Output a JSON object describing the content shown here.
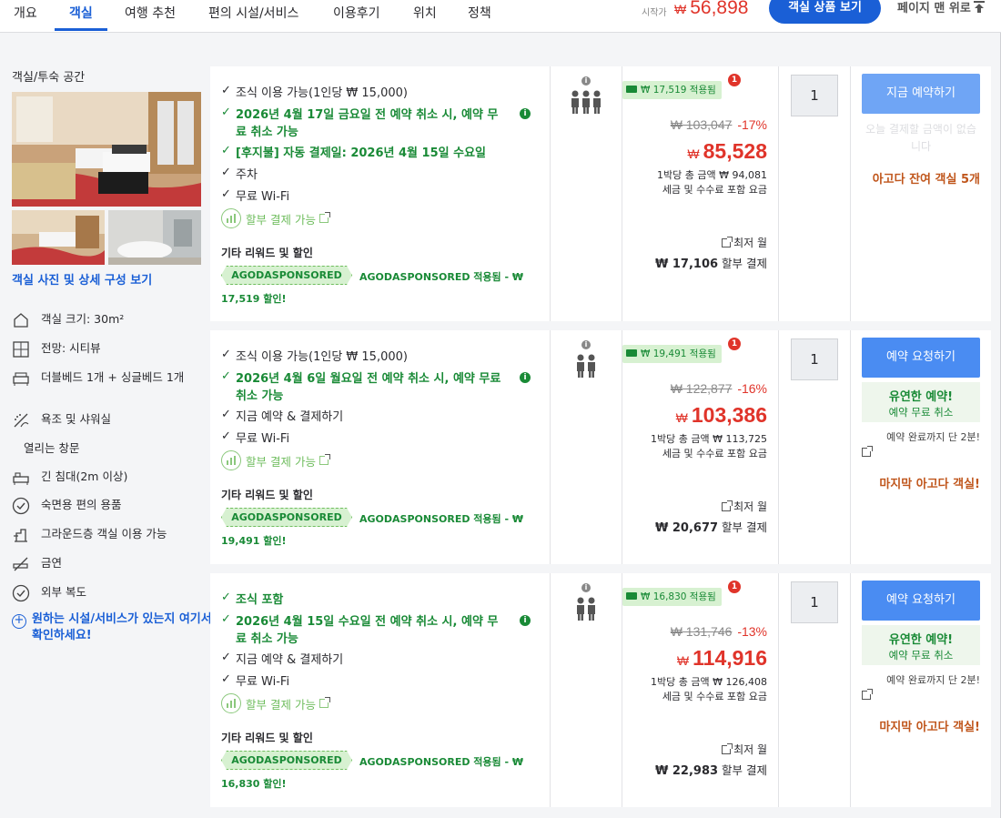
{
  "nav": {
    "tabs": [
      "개요",
      "객실",
      "여행 추천",
      "편의 시설/서비스",
      "이용후기",
      "위치",
      "정책"
    ],
    "start_from_label": "시작가",
    "start_price_currency": "₩",
    "start_price": "56,898",
    "view_button": "객실 상품 보기",
    "back_to_top": "페이지 맨 위로"
  },
  "left": {
    "title": "객실/투숙 공간",
    "photo_link": "객실 사진 및 상세 구성 보기",
    "features": [
      {
        "icon": "room-size-icon",
        "label": "객실 크기: 30m²"
      },
      {
        "icon": "window-view-icon",
        "label": "전망: 시티뷰"
      },
      {
        "icon": "bed-icon",
        "label": "더블베드 1개 + 싱글베드 1개"
      },
      {
        "icon": "shower-icon",
        "label": "욕조 및 샤워실"
      },
      {
        "icon": "",
        "label": "열리는 창문"
      },
      {
        "icon": "long-bed-icon",
        "label": "긴 침대(2m 이상)"
      },
      {
        "icon": "check-circle-icon",
        "label": "숙면용 편의 용품"
      },
      {
        "icon": "ground-floor-icon",
        "label": "그라운드층 객실 이용 가능"
      },
      {
        "icon": "no-smoking-icon",
        "label": "금연"
      },
      {
        "icon": "check-circle-icon",
        "label": "외부 복도"
      }
    ],
    "ask_link": "원하는 시설/서비스가 있는지 여기서 확인하세요!"
  },
  "common": {
    "installment_label": "할부 결제 가능",
    "other_rewards_label": "기타 리워드 및 할인",
    "sponsor_tag": "AGODASPONSORED",
    "monthly_label": "최저 월",
    "installment_suffix": "할부 결제",
    "per_night_prefix": "1박당 총 금액",
    "tax_note": "세금 및 수수료 포함 요금",
    "currency": "₩",
    "info_mark": "i",
    "badge_count": "1"
  },
  "offers": [
    {
      "benefits": [
        {
          "text": "조식 이용 가능(1인당 ₩ 15,000)",
          "green": false
        },
        {
          "text": "2026년 4월 17일 금요일 전 예약 취소 시, 예약 무료 취소 가능",
          "green": true
        },
        {
          "text": "[후지불] 자동 결제일: 2026년 4월 15일 수요일",
          "green": true
        },
        {
          "text": "주차",
          "green": false
        },
        {
          "text": "무료 Wi-Fi",
          "green": false
        }
      ],
      "sponsor_line1": "AGODASPONSORED 적용됨 - ₩",
      "sponsor_line2": "17,519 할인!",
      "occupancy": 3,
      "coupon": "₩ 17,519 적용됨",
      "original_price": "₩ 103,047",
      "discount": "-17%",
      "final_price": "85,528",
      "per_night": "1박당 총 금액 ₩ 94,081",
      "monthly_amount": "₩ 17,106",
      "quantity": "1",
      "book_button": "지금 예약하기",
      "no_pay_note": "오늘 결제할 금액이 없습니다",
      "urgency": "아고다 잔여 객실 5개"
    },
    {
      "benefits": [
        {
          "text": "조식 이용 가능(1인당 ₩ 15,000)",
          "green": false
        },
        {
          "text": "2026년 4월 6일 월요일 전 예약 취소 시, 예약 무료 취소 가능",
          "green": true
        },
        {
          "text": "지금 예약 & 결제하기",
          "green": false
        },
        {
          "text": "무료 Wi-Fi",
          "green": false
        }
      ],
      "sponsor_line1": "AGODASPONSORED 적용됨 - ₩",
      "sponsor_line2": "19,491 할인!",
      "occupancy": 2,
      "coupon": "₩ 19,491 적용됨",
      "original_price": "₩ 122,877",
      "discount": "-16%",
      "final_price": "103,386",
      "per_night": "1박당 총 금액 ₩ 113,725",
      "monthly_amount": "₩ 20,677",
      "quantity": "1",
      "book_button": "예약 요청하기",
      "flex_title": "유연한 예약!",
      "flex_sub": "예약 무료 취소",
      "remain_note": "예약 완료까지 단 2분!",
      "urgency": "마지막 아고다 객실!"
    },
    {
      "benefits": [
        {
          "text": "조식 포함",
          "green": true
        },
        {
          "text": "2026년 4월 15일 수요일 전 예약 취소 시, 예약 무료 취소 가능",
          "green": true
        },
        {
          "text": "지금 예약 & 결제하기",
          "green": false
        },
        {
          "text": "무료 Wi-Fi",
          "green": false
        }
      ],
      "sponsor_line1": "AGODASPONSORED 적용됨 - ₩",
      "sponsor_line2": "16,830 할인!",
      "occupancy": 2,
      "coupon": "₩ 16,830 적용됨",
      "original_price": "₩ 131,746",
      "discount": "-13%",
      "final_price": "114,916",
      "per_night": "1박당 총 금액 ₩ 126,408",
      "monthly_amount": "₩ 22,983",
      "quantity": "1",
      "book_button": "예약 요청하기",
      "flex_title": "유연한 예약!",
      "flex_sub": "예약 무료 취소",
      "remain_note": "예약 완료까지 단 2분!",
      "urgency": "마지막 아고다 객실!"
    }
  ]
}
